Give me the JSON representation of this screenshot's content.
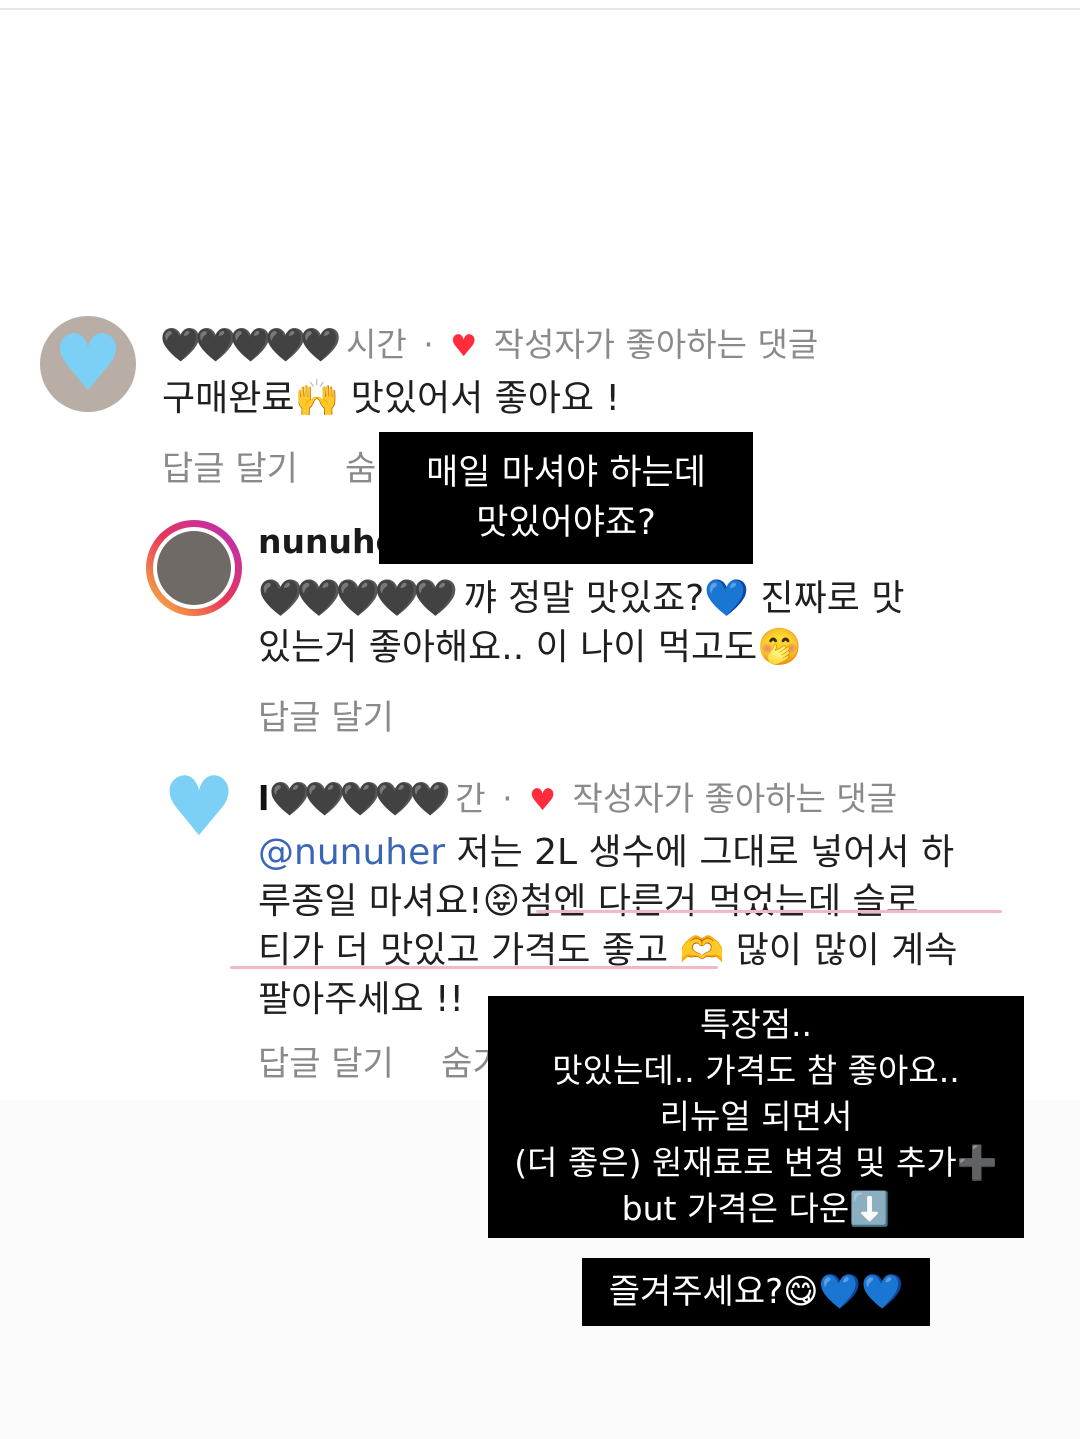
{
  "comment1": {
    "username_hearts": "🖤🖤🖤🖤🖤",
    "time": "시간",
    "liked_label": "작성자가 좋아하는 댓글",
    "text": "구매완료🙌 맛있어서 좋아요 !",
    "reply_label": "답글 달기",
    "hide_label": "숨"
  },
  "reply1": {
    "username": "nunuhe",
    "mention_hearts": "🖤🖤🖤🖤🖤",
    "text_line1": "꺄 정말 맛있죠?💙 진짜로 맛",
    "text_line2": "있는거 좋아해요.. 이 나이 먹고도🤭",
    "reply_label": "답글 달기"
  },
  "comment2": {
    "username_prefix": "l",
    "username_hearts": "🖤🖤🖤🖤🖤",
    "time": "간",
    "liked_label": "작성자가 좋아하는 댓글",
    "mention": "@nunuher",
    "text_line1": " 저는 2L 생수에 그대로 넣어서 하",
    "text_line2": "루종일 마셔요!😝첨엔 다른거 먹었는데 슬로",
    "text_line3": "티가 더 맛있고 가격도 좋고 🫶 많이 많이 계속",
    "text_line4": "팔아주세요 !!",
    "reply_label": "답글 달기",
    "hide_label": "숨기"
  },
  "captions": {
    "top_line1": "매일 마셔야 하는데",
    "top_line2": "맛있어야죠?",
    "mid_line1": "특장점..",
    "mid_line2": "맛있는데.. 가격도 참 좋아요..",
    "mid_line3": "리뉴얼 되면서",
    "mid_line4": "(더 좋은) 원재료로 변경 및 추가➕",
    "mid_line5": "but 가격은 다운⬇️",
    "bottom": "즐겨주세요?😋💙💙"
  }
}
